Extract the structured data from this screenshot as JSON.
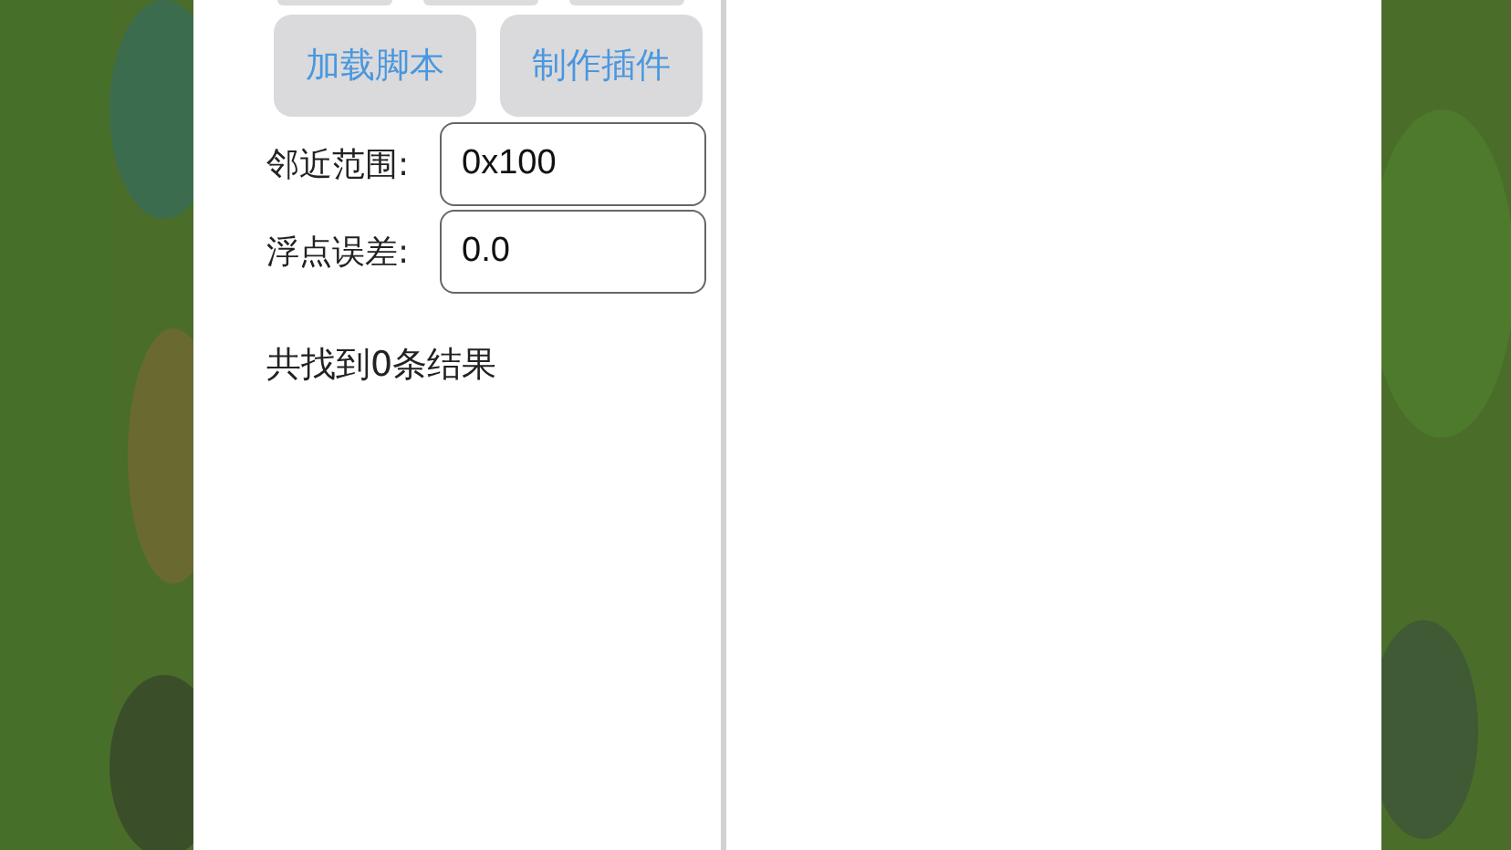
{
  "buttons": [
    {
      "label": "加载脚本"
    },
    {
      "label": "制作插件"
    }
  ],
  "fields": [
    {
      "label": "邻近范围:",
      "value": "0x100"
    },
    {
      "label": "浮点误差:",
      "value": "0.0"
    }
  ],
  "result_text": "共找到0条结果"
}
